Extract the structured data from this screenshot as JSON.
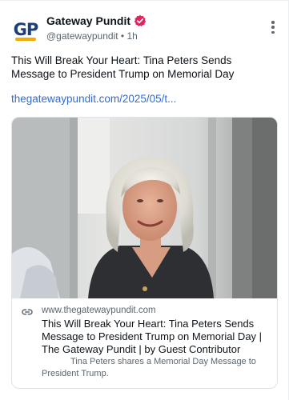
{
  "post": {
    "author_name": "Gateway Pundit",
    "handle": "@gatewaypundit",
    "separator": "•",
    "time": "1h",
    "avatar_text": "GP",
    "text": "This Will Break Your Heart: Tina Peters Sends Message to President Trump on Memorial Day",
    "link_text": "thegatewaypundit.com/2025/05/t..."
  },
  "card": {
    "domain": "www.thegatewaypundit.com",
    "title": "This Will Break Your Heart: Tina Peters Sends Message to President Trump on Memorial Day | The Gateway Pundit | by Guest Contributor",
    "description": "Tina Peters shares a Memorial Day Message to President Trump."
  },
  "icons": {
    "verified": "verified-badge-icon",
    "more": "more-options-icon",
    "link": "link-icon"
  },
  "colors": {
    "link": "#2f6bd7",
    "verified": "#e0245e",
    "text": "#0f1419",
    "muted": "#5b6670"
  }
}
